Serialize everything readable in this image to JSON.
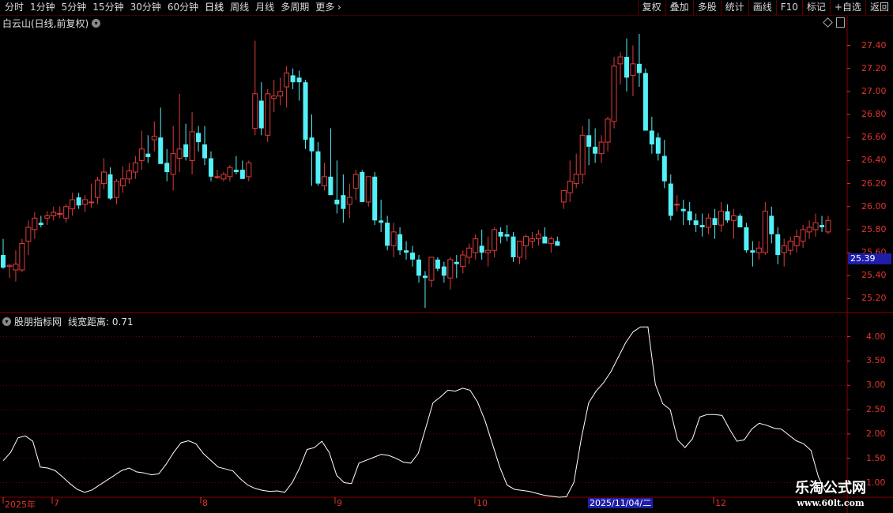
{
  "toolbar": {
    "periods": [
      "分时",
      "1分钟",
      "5分钟",
      "15分钟",
      "30分钟",
      "60分钟",
      "日线",
      "周线",
      "月线",
      "多周期",
      "更多"
    ],
    "active_period": "日线",
    "more_arrow": "chevron-right-icon",
    "buttons": [
      "复权",
      "叠加",
      "多股",
      "统计",
      "画线",
      "F10",
      "标记",
      "+自选",
      "返回"
    ]
  },
  "main_chart": {
    "title": "白云山(日线,前复权)",
    "price_axis": [
      "27.40",
      "27.20",
      "27.00",
      "26.80",
      "26.60",
      "26.40",
      "26.20",
      "26.00",
      "25.80",
      "25.60",
      "25.40",
      "25.20"
    ],
    "current_price": "25.39"
  },
  "indicator": {
    "label": "股朋指标网",
    "series_label": "线宽距离: 0.71",
    "axis": [
      "4.00",
      "3.50",
      "3.00",
      "2.50",
      "2.00",
      "1.50",
      "1.00"
    ]
  },
  "date_axis": {
    "labels": [
      {
        "text": "2025年",
        "pos": 0
      },
      {
        "text": "7",
        "pos": 1
      },
      {
        "text": "8",
        "pos": 2
      },
      {
        "text": "9",
        "pos": 3
      },
      {
        "text": "10",
        "pos": 4
      },
      {
        "text": "12",
        "pos": 5
      }
    ],
    "cursor_date": "2025/11/04/二"
  },
  "colors": {
    "up": "#e03c3c",
    "down": "#54f0f8",
    "axis_red": "#e0352b",
    "panel_border": "#8b0000",
    "indicator_line": "#ffffff",
    "tag_bg": "#1e1ea8"
  },
  "watermark": {
    "title": "乐淘公式网",
    "url": "www.60lt.com"
  },
  "chart_data": [
    {
      "type": "candlestick",
      "title": "白云山(日线,前复权)",
      "y_ticks": [
        27.4,
        27.2,
        27.0,
        26.8,
        26.6,
        26.4,
        26.2,
        26.0,
        25.8,
        25.6,
        25.4,
        25.2
      ],
      "ylim": [
        25.08,
        27.52
      ],
      "candles": [
        [
          25.58,
          25.72,
          25.46,
          25.47
        ],
        [
          25.48,
          25.5,
          25.38,
          25.49
        ],
        [
          25.45,
          25.62,
          25.35,
          25.5
        ],
        [
          25.45,
          25.72,
          25.43,
          25.68
        ],
        [
          25.7,
          25.88,
          25.58,
          25.82
        ],
        [
          25.8,
          25.95,
          25.72,
          25.9
        ],
        [
          25.86,
          25.92,
          25.82,
          25.84
        ],
        [
          25.9,
          25.96,
          25.84,
          25.92
        ],
        [
          25.92,
          26.0,
          25.88,
          25.95
        ],
        [
          25.94,
          26.0,
          25.9,
          25.94
        ],
        [
          25.9,
          26.02,
          25.86,
          26.0
        ],
        [
          25.98,
          26.12,
          25.92,
          26.06
        ],
        [
          26.08,
          26.12,
          25.98,
          26.01
        ],
        [
          26.02,
          26.1,
          25.95,
          26.06
        ],
        [
          26.04,
          26.2,
          25.99,
          26.04
        ],
        [
          26.08,
          26.26,
          26.02,
          26.23
        ],
        [
          26.2,
          26.42,
          26.15,
          26.3
        ],
        [
          26.28,
          26.34,
          26.06,
          26.07
        ],
        [
          26.08,
          26.24,
          26.02,
          26.22
        ],
        [
          26.18,
          26.35,
          26.12,
          26.24
        ],
        [
          26.24,
          26.38,
          26.2,
          26.31
        ],
        [
          26.3,
          26.44,
          26.24,
          26.38
        ],
        [
          26.4,
          26.66,
          26.32,
          26.5
        ],
        [
          26.46,
          26.62,
          26.38,
          26.43
        ],
        [
          26.58,
          26.74,
          26.48,
          26.61
        ],
        [
          26.6,
          26.86,
          26.4,
          26.37
        ],
        [
          26.38,
          26.5,
          26.22,
          26.3
        ],
        [
          26.28,
          26.7,
          26.14,
          26.46
        ],
        [
          26.42,
          26.98,
          26.3,
          26.5
        ],
        [
          26.54,
          26.72,
          26.4,
          26.43
        ],
        [
          26.4,
          26.82,
          26.28,
          26.65
        ],
        [
          26.64,
          26.7,
          26.48,
          26.56
        ],
        [
          26.54,
          26.7,
          26.36,
          26.42
        ],
        [
          26.42,
          26.48,
          26.22,
          26.26
        ],
        [
          26.26,
          26.32,
          26.24,
          26.26
        ],
        [
          26.24,
          26.3,
          26.22,
          26.28
        ],
        [
          26.26,
          26.36,
          26.22,
          26.34
        ],
        [
          26.32,
          26.44,
          26.28,
          26.3
        ],
        [
          26.32,
          26.4,
          26.24,
          26.24
        ],
        [
          26.26,
          26.4,
          26.22,
          26.38
        ],
        [
          26.68,
          27.44,
          26.62,
          26.98
        ],
        [
          26.92,
          27.08,
          26.62,
          26.68
        ],
        [
          26.62,
          27.02,
          26.56,
          26.98
        ],
        [
          26.94,
          27.1,
          26.82,
          26.96
        ],
        [
          26.96,
          27.12,
          26.88,
          27.0
        ],
        [
          27.04,
          27.22,
          26.86,
          27.16
        ],
        [
          27.14,
          27.2,
          27.02,
          27.08
        ],
        [
          27.12,
          27.18,
          26.92,
          27.08
        ],
        [
          27.08,
          27.1,
          26.5,
          26.58
        ],
        [
          26.6,
          26.8,
          26.18,
          26.48
        ],
        [
          26.48,
          26.56,
          26.18,
          26.2
        ],
        [
          26.18,
          26.38,
          26.14,
          26.26
        ],
        [
          26.26,
          26.68,
          26.2,
          26.1
        ],
        [
          26.06,
          26.4,
          25.94,
          26.02
        ],
        [
          26.1,
          26.28,
          25.86,
          25.98
        ],
        [
          26.02,
          26.2,
          25.9,
          26.08
        ],
        [
          26.16,
          26.32,
          26.06,
          26.28
        ],
        [
          26.3,
          26.32,
          26.04,
          26.04
        ],
        [
          26.04,
          26.26,
          26.0,
          26.26
        ],
        [
          26.26,
          26.3,
          25.84,
          25.88
        ],
        [
          25.88,
          26.06,
          25.78,
          25.86
        ],
        [
          25.86,
          25.92,
          25.62,
          25.66
        ],
        [
          25.66,
          25.86,
          25.56,
          25.78
        ],
        [
          25.76,
          25.82,
          25.58,
          25.62
        ],
        [
          25.62,
          25.7,
          25.54,
          25.6
        ],
        [
          25.6,
          25.66,
          25.48,
          25.54
        ],
        [
          25.54,
          25.58,
          25.34,
          25.4
        ],
        [
          25.4,
          25.44,
          25.12,
          25.38
        ],
        [
          25.36,
          25.56,
          25.3,
          25.56
        ],
        [
          25.54,
          25.56,
          25.44,
          25.46
        ],
        [
          25.48,
          25.52,
          25.34,
          25.4
        ],
        [
          25.38,
          25.56,
          25.28,
          25.54
        ],
        [
          25.52,
          25.58,
          25.38,
          25.5
        ],
        [
          25.48,
          25.62,
          25.42,
          25.58
        ],
        [
          25.56,
          25.68,
          25.5,
          25.64
        ],
        [
          25.6,
          25.76,
          25.54,
          25.72
        ],
        [
          25.66,
          25.8,
          25.54,
          25.6
        ],
        [
          25.6,
          25.74,
          25.48,
          25.62
        ],
        [
          25.62,
          25.82,
          25.56,
          25.8
        ],
        [
          25.78,
          25.82,
          25.68,
          25.74
        ],
        [
          25.76,
          25.84,
          25.7,
          25.74
        ],
        [
          25.74,
          25.78,
          25.52,
          25.56
        ],
        [
          25.56,
          25.64,
          25.5,
          25.7
        ],
        [
          25.66,
          25.76,
          25.54,
          25.74
        ],
        [
          25.7,
          25.78,
          25.64,
          25.72
        ],
        [
          25.72,
          25.8,
          25.66,
          25.76
        ],
        [
          25.74,
          25.82,
          25.7,
          25.68
        ],
        [
          25.68,
          25.74,
          25.6,
          25.72
        ],
        [
          25.7,
          25.74,
          25.66,
          25.66
        ],
        [
          26.04,
          26.08,
          25.98,
          26.14
        ],
        [
          26.12,
          26.4,
          26.04,
          26.22
        ],
        [
          26.2,
          26.46,
          26.16,
          26.28
        ],
        [
          26.28,
          26.7,
          26.2,
          26.62
        ],
        [
          26.62,
          26.76,
          26.36,
          26.52
        ],
        [
          26.52,
          26.68,
          26.38,
          26.46
        ],
        [
          26.46,
          26.62,
          26.38,
          26.56
        ],
        [
          26.56,
          26.78,
          26.48,
          26.76
        ],
        [
          26.74,
          27.3,
          26.68,
          27.22
        ],
        [
          27.24,
          27.34,
          27.06,
          27.3
        ],
        [
          27.3,
          27.46,
          27.0,
          27.12
        ],
        [
          27.14,
          27.4,
          26.96,
          27.24
        ],
        [
          27.24,
          27.5,
          27.04,
          27.16
        ],
        [
          27.16,
          27.2,
          26.68,
          26.66
        ],
        [
          26.66,
          26.78,
          26.46,
          26.54
        ],
        [
          26.6,
          26.64,
          26.4,
          26.46
        ],
        [
          26.44,
          26.58,
          26.16,
          26.22
        ],
        [
          26.2,
          26.28,
          25.88,
          25.92
        ],
        [
          26.02,
          26.1,
          25.96,
          26.02
        ],
        [
          25.98,
          26.06,
          25.84,
          25.96
        ],
        [
          25.96,
          26.04,
          25.84,
          25.88
        ],
        [
          25.88,
          25.94,
          25.78,
          25.84
        ],
        [
          25.84,
          25.94,
          25.74,
          25.82
        ],
        [
          25.82,
          25.94,
          25.76,
          25.9
        ],
        [
          25.9,
          25.98,
          25.72,
          25.84
        ],
        [
          25.84,
          26.04,
          25.78,
          25.96
        ],
        [
          25.96,
          26.02,
          25.86,
          25.88
        ],
        [
          25.88,
          25.98,
          25.72,
          25.92
        ],
        [
          25.92,
          25.94,
          25.82,
          25.82
        ],
        [
          25.82,
          25.86,
          25.6,
          25.62
        ],
        [
          25.62,
          25.7,
          25.48,
          25.6
        ],
        [
          25.6,
          25.7,
          25.54,
          25.64
        ],
        [
          25.6,
          26.04,
          25.58,
          25.96
        ],
        [
          25.92,
          26.0,
          25.68,
          25.76
        ],
        [
          25.76,
          25.82,
          25.5,
          25.58
        ],
        [
          25.6,
          25.72,
          25.48,
          25.66
        ],
        [
          25.62,
          25.74,
          25.58,
          25.7
        ],
        [
          25.66,
          25.8,
          25.6,
          25.74
        ],
        [
          25.7,
          25.84,
          25.64,
          25.8
        ],
        [
          25.78,
          25.88,
          25.72,
          25.82
        ],
        [
          25.8,
          25.94,
          25.74,
          25.86
        ],
        [
          25.84,
          25.92,
          25.78,
          25.82
        ],
        [
          25.78,
          25.92,
          25.76,
          25.88
        ]
      ]
    },
    {
      "type": "line",
      "title": "线宽距离",
      "ylabel": "",
      "y_ticks": [
        4.0,
        3.5,
        3.0,
        2.5,
        2.0,
        1.5,
        1.0
      ],
      "ylim": [
        0.7,
        4.35
      ],
      "series": [
        {
          "name": "线宽距离",
          "values": [
            1.45,
            1.62,
            1.92,
            1.96,
            1.85,
            1.32,
            1.3,
            1.25,
            1.12,
            0.98,
            0.86,
            0.8,
            0.85,
            0.95,
            1.05,
            1.15,
            1.25,
            1.3,
            1.22,
            1.2,
            1.16,
            1.18,
            1.38,
            1.62,
            1.82,
            1.86,
            1.8,
            1.6,
            1.46,
            1.32,
            1.28,
            1.24,
            1.08,
            0.95,
            0.88,
            0.84,
            0.82,
            0.83,
            0.8,
            1.0,
            1.3,
            1.68,
            1.72,
            1.85,
            1.62,
            1.15,
            1.0,
            0.98,
            1.4,
            1.46,
            1.52,
            1.58,
            1.56,
            1.5,
            1.42,
            1.4,
            1.6,
            2.12,
            2.64,
            2.76,
            2.9,
            2.88,
            2.94,
            2.9,
            2.66,
            2.28,
            1.8,
            1.32,
            0.95,
            0.86,
            0.84,
            0.82,
            0.78,
            0.74,
            0.72,
            0.7,
            0.71,
            1.0,
            1.9,
            2.64,
            2.88,
            3.05,
            3.28,
            3.58,
            3.88,
            4.1,
            4.2,
            4.2,
            3.02,
            2.62,
            2.5,
            1.88,
            1.72,
            1.9,
            2.35,
            2.4,
            2.4,
            2.38,
            2.1,
            1.85,
            1.88,
            2.1,
            2.22,
            2.18,
            2.12,
            2.1,
            1.98,
            1.86,
            1.8,
            1.66,
            1.12,
            0.8
          ]
        }
      ]
    }
  ]
}
